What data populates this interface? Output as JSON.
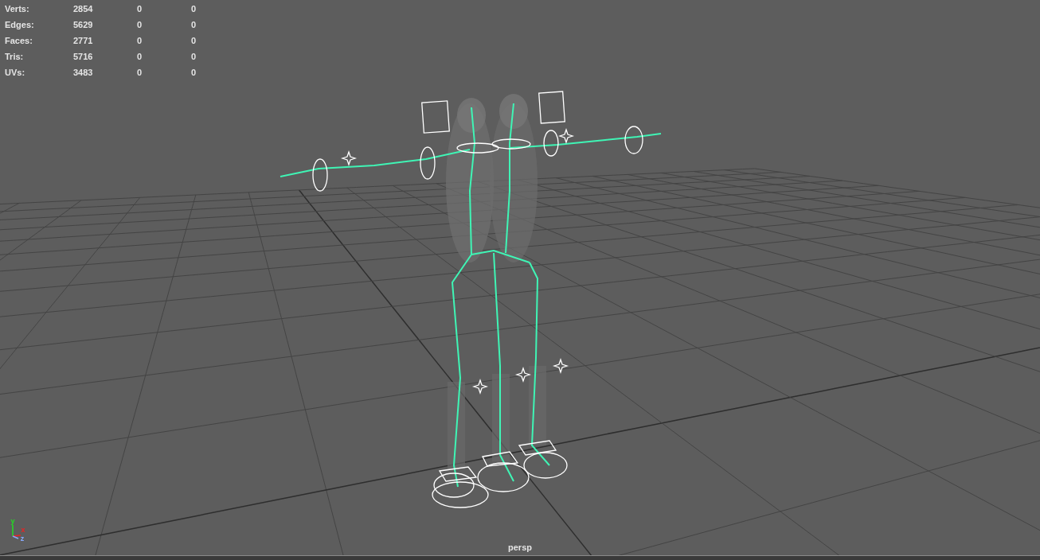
{
  "hud": {
    "rows": [
      {
        "label": "Verts:",
        "values": [
          "2854",
          "0",
          "0"
        ]
      },
      {
        "label": "Edges:",
        "values": [
          "5629",
          "0",
          "0"
        ]
      },
      {
        "label": "Faces:",
        "values": [
          "2771",
          "0",
          "0"
        ]
      },
      {
        "label": "Tris:",
        "values": [
          "5716",
          "0",
          "0"
        ]
      },
      {
        "label": "UVs:",
        "values": [
          "3483",
          "0",
          "0"
        ]
      }
    ]
  },
  "axes": [
    {
      "label": "y",
      "color": "#22dd22"
    },
    {
      "label": "x",
      "color": "#ee2222"
    },
    {
      "label": "z",
      "color": "#88aaff"
    }
  ],
  "camera_label": "persp"
}
